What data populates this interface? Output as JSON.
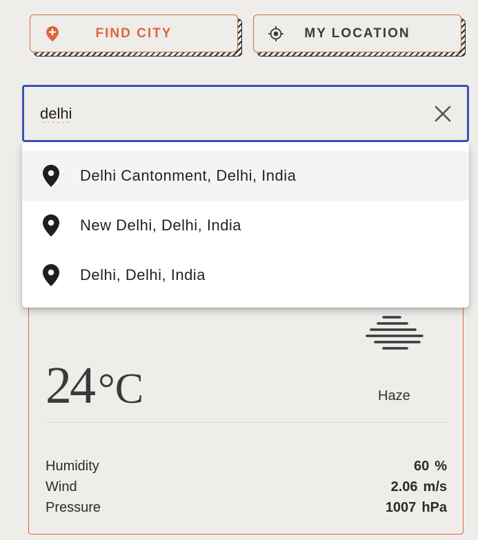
{
  "toolbar": {
    "find_city_label": "FIND CITY",
    "find_city_icon": "location-pin-plus-icon",
    "my_location_label": "MY LOCATION",
    "my_location_icon": "crosshair-target-icon"
  },
  "search": {
    "value": "delhi",
    "clear_icon": "close-icon"
  },
  "suggestions": [
    {
      "label": "Delhi Cantonment, Delhi, India",
      "icon": "map-pin-icon",
      "highlighted": true
    },
    {
      "label": "New Delhi, Delhi, India",
      "icon": "map-pin-icon",
      "highlighted": false
    },
    {
      "label": "Delhi, Delhi, India",
      "icon": "map-pin-icon",
      "highlighted": false
    }
  ],
  "weather": {
    "temperature": "24",
    "unit": "°C",
    "condition": "Haze",
    "condition_icon": "haze-icon",
    "stats": [
      {
        "label": "Humidity",
        "value": "60",
        "unit": "%"
      },
      {
        "label": "Wind",
        "value": "2.06",
        "unit": "m/s"
      },
      {
        "label": "Pressure",
        "value": "1007",
        "unit": "hPa"
      }
    ]
  },
  "colors": {
    "accent": "#e0653a",
    "focus": "#3f51b5",
    "background": "#efedea"
  }
}
